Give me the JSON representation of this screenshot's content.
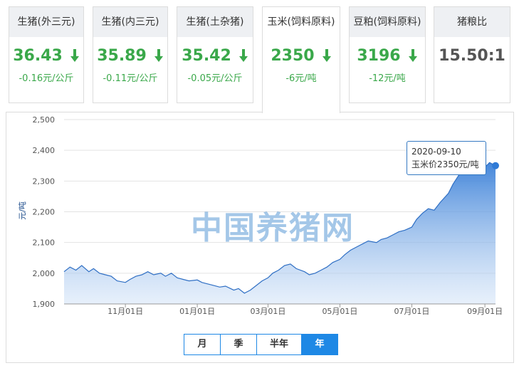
{
  "cards": [
    {
      "title": "生猪(外三元)",
      "price": "36.43",
      "change": "-0.16元/公斤",
      "trend": "down"
    },
    {
      "title": "生猪(内三元)",
      "price": "35.89",
      "change": "-0.11元/公斤",
      "trend": "down"
    },
    {
      "title": "生猪(土杂猪)",
      "price": "35.42",
      "change": "-0.05元/公斤",
      "trend": "down"
    },
    {
      "title": "玉米(饲料原料)",
      "price": "2350",
      "change": "-6元/吨",
      "trend": "down"
    },
    {
      "title": "豆粕(饲料原料)",
      "price": "3196",
      "change": "-12元/吨",
      "trend": "down"
    },
    {
      "title": "猪粮比",
      "price": "15.50:1",
      "change": "",
      "trend": "none"
    }
  ],
  "active_card_index": 3,
  "colors": {
    "down": "#3aa84a",
    "line": "#2f6fc4",
    "fill_top": "#3a80d8",
    "accent": "#1e88e5"
  },
  "watermark": "中国养猪网",
  "tooltip": {
    "date": "2020-09-10",
    "label": "玉米价2350元/吨"
  },
  "periods": [
    "月",
    "季",
    "半年",
    "年"
  ],
  "active_period": "年",
  "chart_data": {
    "type": "area",
    "title": "",
    "xlabel": "",
    "ylabel": "元/吨",
    "ylim": [
      1900,
      2500
    ],
    "yticks": [
      1900,
      2000,
      2100,
      2200,
      2300,
      2400,
      2500
    ],
    "ytick_labels": [
      "1,900",
      "2,000",
      "2,100",
      "2,200",
      "2,300",
      "2,400",
      "2,500"
    ],
    "xtick_labels": [
      "11月01日",
      "01月01日",
      "03月01日",
      "05月01日",
      "07月01日",
      "09月01日"
    ],
    "xtick_dates": [
      "2019-11-01",
      "2020-01-01",
      "2020-03-01",
      "2020-05-01",
      "2020-07-01",
      "2020-09-01"
    ],
    "x_range": [
      "2019-09-10",
      "2020-09-10"
    ],
    "grid": true,
    "legend": "none",
    "series": [
      {
        "points": [
          [
            "2019-09-10",
            2005
          ],
          [
            "2019-09-15",
            2020
          ],
          [
            "2019-09-20",
            2010
          ],
          [
            "2019-09-25",
            2025
          ],
          [
            "2019-10-01",
            2005
          ],
          [
            "2019-10-05",
            2015
          ],
          [
            "2019-10-10",
            2000
          ],
          [
            "2019-10-15",
            1995
          ],
          [
            "2019-10-20",
            1990
          ],
          [
            "2019-10-25",
            1975
          ],
          [
            "2019-11-01",
            1970
          ],
          [
            "2019-11-05",
            1980
          ],
          [
            "2019-11-10",
            1990
          ],
          [
            "2019-11-15",
            1995
          ],
          [
            "2019-11-20",
            2005
          ],
          [
            "2019-11-25",
            1995
          ],
          [
            "2019-12-01",
            2000
          ],
          [
            "2019-12-05",
            1990
          ],
          [
            "2019-12-10",
            2000
          ],
          [
            "2019-12-15",
            1985
          ],
          [
            "2019-12-20",
            1980
          ],
          [
            "2019-12-25",
            1975
          ],
          [
            "2020-01-01",
            1978
          ],
          [
            "2020-01-05",
            1970
          ],
          [
            "2020-01-10",
            1965
          ],
          [
            "2020-01-15",
            1960
          ],
          [
            "2020-01-20",
            1955
          ],
          [
            "2020-01-25",
            1958
          ],
          [
            "2020-02-01",
            1945
          ],
          [
            "2020-02-05",
            1950
          ],
          [
            "2020-02-10",
            1935
          ],
          [
            "2020-02-15",
            1945
          ],
          [
            "2020-02-20",
            1960
          ],
          [
            "2020-02-25",
            1975
          ],
          [
            "2020-03-01",
            1985
          ],
          [
            "2020-03-05",
            2000
          ],
          [
            "2020-03-10",
            2010
          ],
          [
            "2020-03-15",
            2025
          ],
          [
            "2020-03-20",
            2030
          ],
          [
            "2020-03-25",
            2015
          ],
          [
            "2020-04-01",
            2005
          ],
          [
            "2020-04-05",
            1995
          ],
          [
            "2020-04-10",
            2000
          ],
          [
            "2020-04-15",
            2010
          ],
          [
            "2020-04-20",
            2020
          ],
          [
            "2020-04-25",
            2035
          ],
          [
            "2020-05-01",
            2045
          ],
          [
            "2020-05-05",
            2060
          ],
          [
            "2020-05-10",
            2075
          ],
          [
            "2020-05-15",
            2085
          ],
          [
            "2020-05-20",
            2095
          ],
          [
            "2020-05-25",
            2105
          ],
          [
            "2020-06-01",
            2100
          ],
          [
            "2020-06-05",
            2110
          ],
          [
            "2020-06-10",
            2115
          ],
          [
            "2020-06-15",
            2125
          ],
          [
            "2020-06-20",
            2135
          ],
          [
            "2020-06-25",
            2140
          ],
          [
            "2020-07-01",
            2150
          ],
          [
            "2020-07-05",
            2175
          ],
          [
            "2020-07-10",
            2195
          ],
          [
            "2020-07-15",
            2210
          ],
          [
            "2020-07-20",
            2205
          ],
          [
            "2020-07-25",
            2230
          ],
          [
            "2020-08-01",
            2260
          ],
          [
            "2020-08-05",
            2290
          ],
          [
            "2020-08-10",
            2320
          ],
          [
            "2020-08-15",
            2345
          ],
          [
            "2020-08-20",
            2335
          ],
          [
            "2020-08-25",
            2360
          ],
          [
            "2020-09-01",
            2345
          ],
          [
            "2020-09-05",
            2360
          ],
          [
            "2020-09-10",
            2350
          ]
        ]
      }
    ]
  }
}
